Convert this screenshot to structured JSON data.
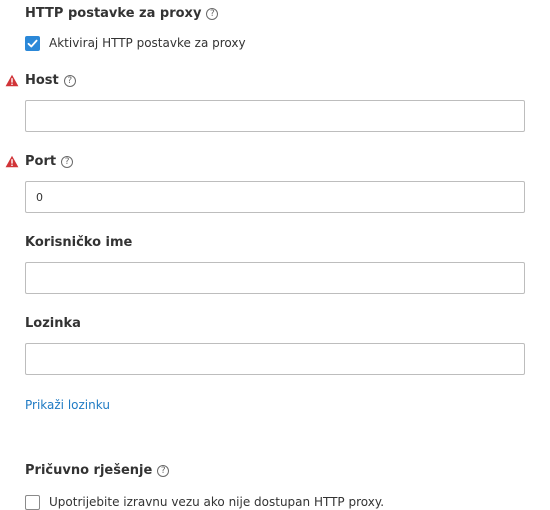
{
  "proxy_section": {
    "title": "HTTP postavke za proxy",
    "help_icon": "help-icon",
    "enable_checkbox": {
      "label": "Aktiviraj HTTP postavke za proxy",
      "checked": true
    }
  },
  "fields": {
    "host": {
      "label": "Host",
      "value": "",
      "warning_icon": "warning-icon",
      "warning_color": "#d13438"
    },
    "port": {
      "label": "Port",
      "value": "0",
      "warning_icon": "warning-icon",
      "warning_color": "#d13438"
    },
    "username": {
      "label": "Korisničko ime",
      "value": ""
    },
    "password": {
      "label": "Lozinka",
      "value": ""
    }
  },
  "show_password_link": "Prikaži lozinku",
  "fallback_section": {
    "title": "Pričuvno rješenje",
    "help_icon": "help-icon",
    "direct_checkbox": {
      "label": "Upotrijebite izravnu vezu ako nije dostupan HTTP proxy.",
      "checked": false
    }
  },
  "colors": {
    "accent": "#2b88d8",
    "link": "#1f7bc4",
    "border": "#bdbdbd",
    "text": "#333333"
  }
}
